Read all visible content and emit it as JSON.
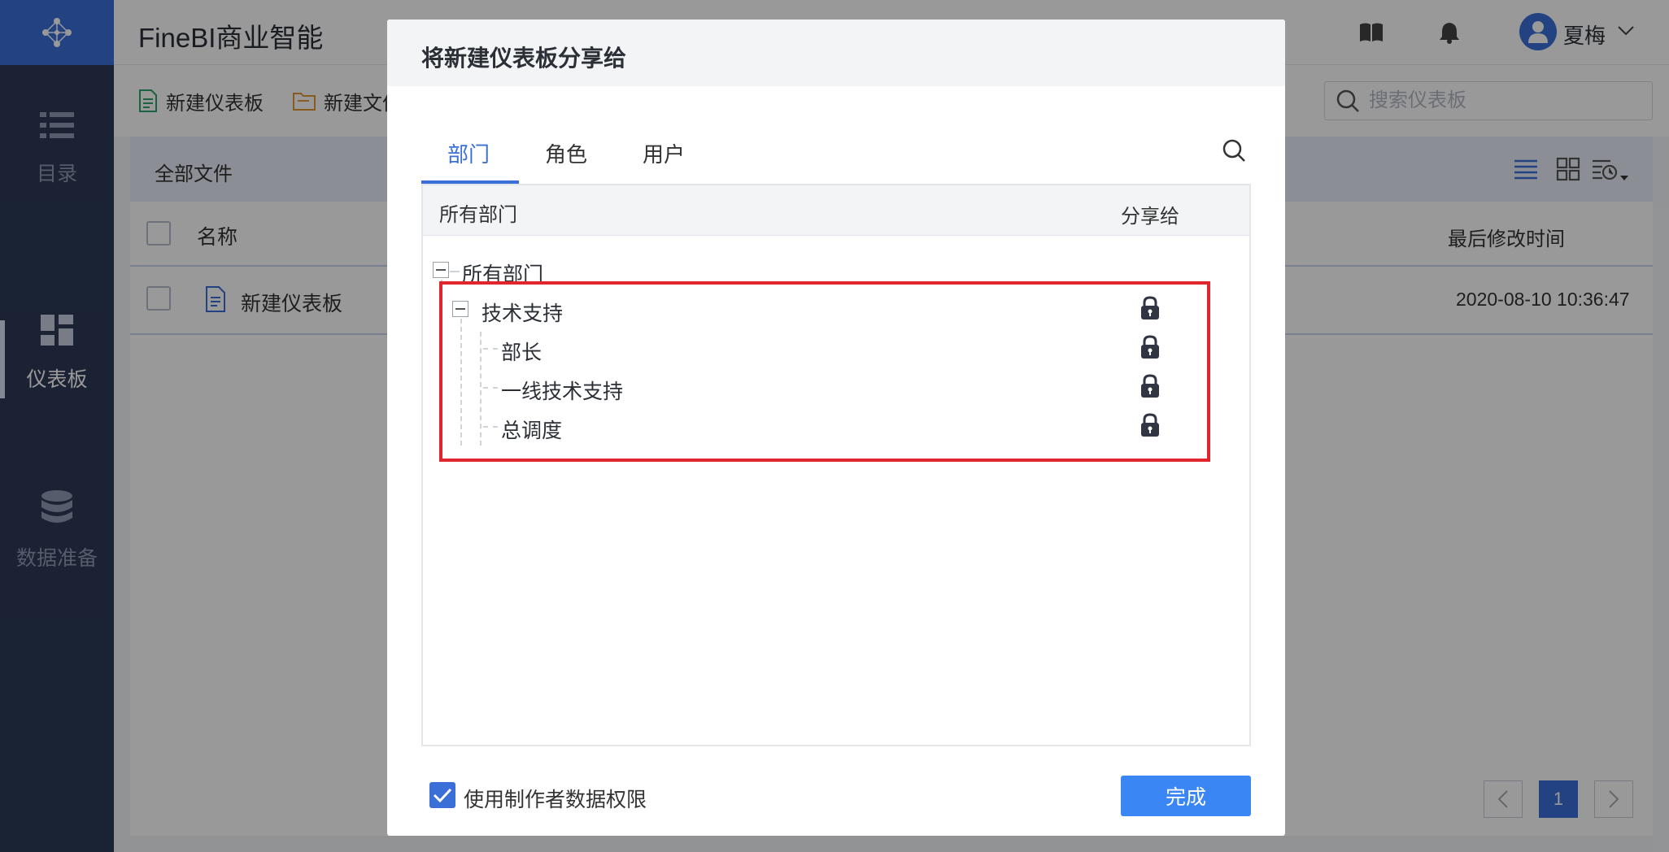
{
  "app": {
    "title": "FineBI商业智能"
  },
  "sidebar": {
    "items": [
      {
        "label": "目录",
        "icon": "list-icon"
      },
      {
        "label": "仪表板",
        "icon": "dashboard-icon"
      },
      {
        "label": "数据准备",
        "icon": "database-icon"
      }
    ]
  },
  "header": {
    "user_name": "夏梅"
  },
  "toolbar": {
    "new_dashboard": "新建仪表板",
    "new_folder": "新建文件夹",
    "search_placeholder": "搜索仪表板"
  },
  "files": {
    "breadcrumb": "全部文件",
    "columns": {
      "name": "名称",
      "modified": "最后修改时间"
    },
    "rows": [
      {
        "name": "新建仪表板",
        "modified": "2020-08-10 10:36:47"
      }
    ],
    "current_page": "1"
  },
  "dialog": {
    "title": "将新建仪表板分享给",
    "tabs": [
      "部门",
      "角色",
      "用户"
    ],
    "active_tab": 0,
    "tree_header": {
      "left": "所有部门",
      "right": "分享给"
    },
    "tree": {
      "root": "所有部门",
      "group": "技术支持",
      "children": [
        "部长",
        "一线技术支持",
        "总调度"
      ]
    },
    "use_creator_permission": {
      "label": "使用制作者数据权限",
      "checked": true
    },
    "done_label": "完成"
  },
  "colors": {
    "accent": "#3a6fd8",
    "highlight": "#e0262c",
    "sidebar": "#2c3a55"
  }
}
